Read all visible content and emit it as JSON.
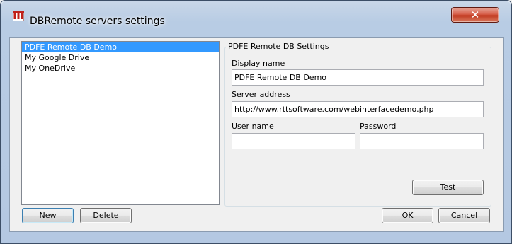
{
  "window": {
    "title": "DBRemote servers settings",
    "close_glyph": "✕",
    "icon": "pdfe-app-icon"
  },
  "servers": {
    "items": [
      {
        "label": "PDFE Remote DB Demo",
        "selected": true
      },
      {
        "label": "My Google Drive",
        "selected": false
      },
      {
        "label": "My OneDrive",
        "selected": false
      }
    ]
  },
  "settings": {
    "group_title": "PDFE Remote DB Settings",
    "display_name_label": "Display name",
    "display_name_value": "PDFE Remote DB Demo",
    "server_address_label": "Server address",
    "server_address_value": "http://www.rttsoftware.com/webinterfacedemo.php",
    "user_name_label": "User name",
    "user_name_value": "",
    "password_label": "Password",
    "password_value": "",
    "test_label": "Test"
  },
  "buttons": {
    "new_label": "New",
    "delete_label": "Delete",
    "ok_label": "OK",
    "cancel_label": "Cancel"
  },
  "colors": {
    "selection": "#3399ff",
    "close_button": "#c13b22"
  }
}
